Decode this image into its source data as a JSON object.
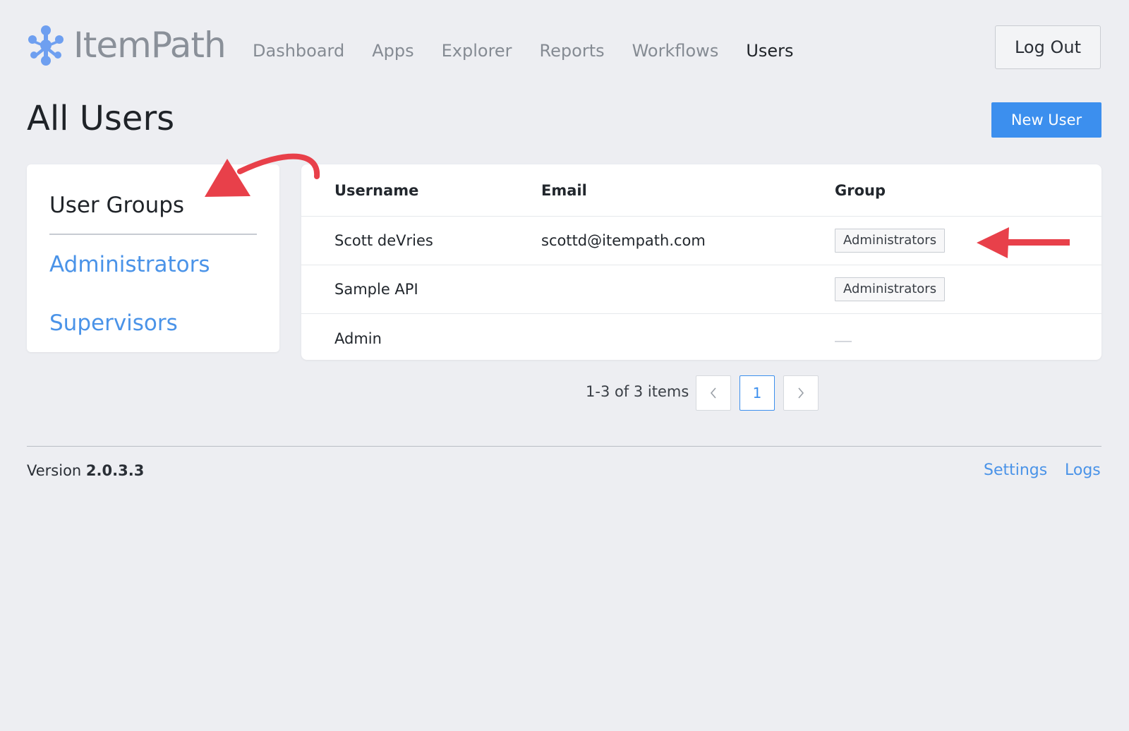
{
  "header": {
    "brand": "ItemPath",
    "nav": [
      {
        "label": "Dashboard",
        "active": false
      },
      {
        "label": "Apps",
        "active": false
      },
      {
        "label": "Explorer",
        "active": false
      },
      {
        "label": "Reports",
        "active": false
      },
      {
        "label": "Workflows",
        "active": false
      },
      {
        "label": "Users",
        "active": true
      }
    ],
    "logout_label": "Log Out"
  },
  "page": {
    "title": "All Users",
    "new_user_label": "New User"
  },
  "groups": {
    "heading": "User Groups",
    "items": [
      "Administrators",
      "Supervisors"
    ]
  },
  "table": {
    "columns": [
      "Username",
      "Email",
      "Group"
    ],
    "rows": [
      {
        "username": "Scott deVries",
        "email": "scottd@itempath.com",
        "group": "Administrators"
      },
      {
        "username": "Sample API",
        "email": "",
        "group": "Administrators"
      },
      {
        "username": "Admin",
        "email": "",
        "group": ""
      }
    ]
  },
  "pagination": {
    "summary": "1-3 of 3 items",
    "current_page": "1",
    "prev_icon": "chevron-left-icon",
    "next_icon": "chevron-right-icon"
  },
  "footer": {
    "version_label": "Version",
    "version_number": "2.0.3.3",
    "links": [
      "Settings",
      "Logs"
    ]
  },
  "colors": {
    "accent": "#3c8fee",
    "link": "#4a93e8",
    "background": "#edeef2",
    "annotation": "#e8404a"
  }
}
